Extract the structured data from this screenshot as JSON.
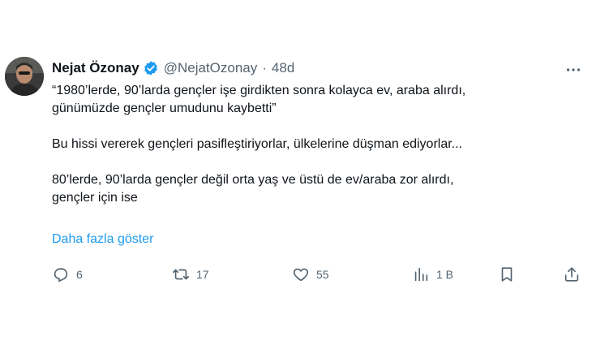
{
  "author": {
    "name": "Nejat Özonay",
    "handle": "@NejatOzonay",
    "separator": "·",
    "time": "48d",
    "verified": true
  },
  "tweet": {
    "lines": [
      "“1980’lerde, 90’larda gençler işe girdikten sonra kolayca ev, araba alırdı,",
      "günümüzde gençler umudunu kaybetti”",
      "Bu hissi vererek gençleri pasifleştiriyorlar, ülkelerine düşman ediyorlar...",
      "80’lerde, 90’larda gençler değil orta yaş ve üstü de ev/araba zor alırdı,",
      "gençler için ise"
    ],
    "show_more": "Daha fazla göster"
  },
  "actions": {
    "reply": {
      "icon": "reply-icon",
      "count": "6"
    },
    "retweet": {
      "icon": "retweet-icon",
      "count": "17"
    },
    "like": {
      "icon": "heart-icon",
      "count": "55"
    },
    "views": {
      "icon": "views-icon",
      "count": "1 B"
    },
    "share": {
      "icon": "share-icon"
    }
  },
  "colors": {
    "text": "#0f1419",
    "muted": "#536471",
    "accent": "#1d9bf0"
  }
}
